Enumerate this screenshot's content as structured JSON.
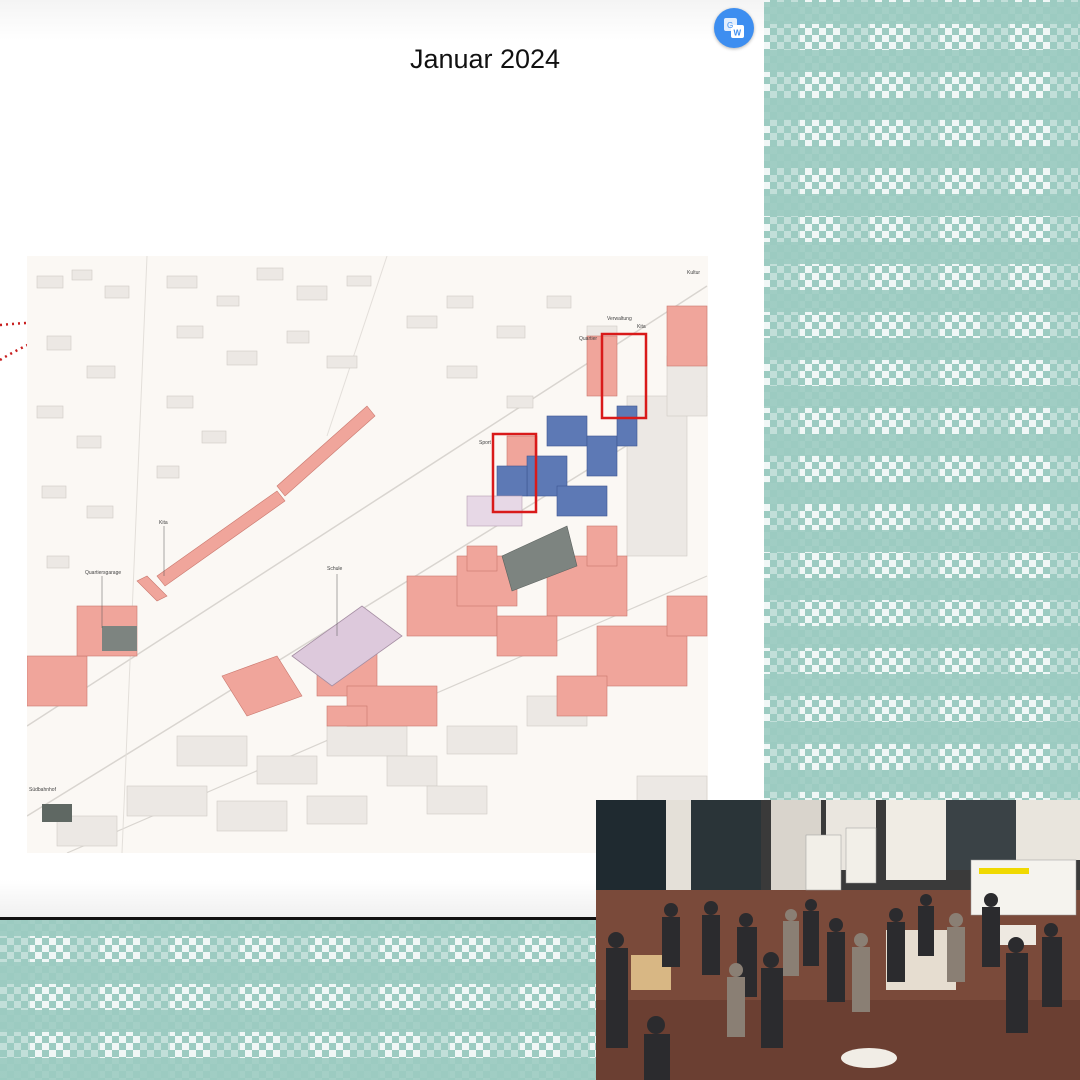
{
  "slide": {
    "title": "Januar 2024"
  },
  "translate_button": {
    "icon": "translate-icon",
    "color": "#3d8ef0"
  },
  "map": {
    "labels": {
      "kultur": "Kultur",
      "verwaltung": "Verwaltung",
      "kita_east": "Kita",
      "quartier": "Quartier",
      "sport": "Sport",
      "kita_west": "Kita",
      "quartiersgarage": "Quartiersgarage",
      "schule": "Schule",
      "sueden": "Südbahnhof"
    },
    "highlight_color": "#d91a1a",
    "building_colors": {
      "existing": "#eeeae6",
      "new_residential": "#f0a59b",
      "new_mixed": "#5d79b5",
      "school": "#ddc9dc",
      "parking": "#7d8480"
    }
  },
  "video": {
    "description_icon": "webcam-feed-icon"
  },
  "colors": {
    "pattern_teal": "#9ccbc1"
  }
}
